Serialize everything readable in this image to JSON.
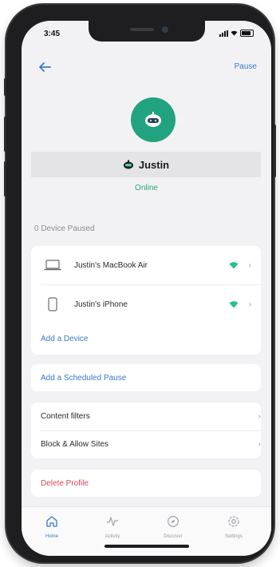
{
  "status_bar": {
    "time": "3:45"
  },
  "header": {
    "pause_label": "Pause"
  },
  "profile": {
    "name": "Justin",
    "status": "Online"
  },
  "devices": {
    "section_label": "0 Device Paused",
    "items": [
      {
        "label": "Justin's MacBook Air",
        "icon": "laptop-icon"
      },
      {
        "label": "Justin's iPhone",
        "icon": "phone-icon"
      }
    ],
    "add_label": "Add a Device"
  },
  "schedule": {
    "add_label": "Add a Scheduled Pause"
  },
  "settings": {
    "items": [
      {
        "label": "Content filters"
      },
      {
        "label": "Block & Allow Sites"
      }
    ]
  },
  "danger": {
    "delete_label": "Delete Profile"
  },
  "tabs": [
    {
      "label": "Home",
      "icon": "home-icon",
      "active": true
    },
    {
      "label": "Activity",
      "icon": "activity-icon",
      "active": false
    },
    {
      "label": "Discover",
      "icon": "discover-icon",
      "active": false
    },
    {
      "label": "Settings",
      "icon": "settings-icon",
      "active": false
    }
  ],
  "colors": {
    "accent": "#3a78c9",
    "online": "#2aa872",
    "avatar": "#22a37f",
    "danger": "#d44a52"
  }
}
